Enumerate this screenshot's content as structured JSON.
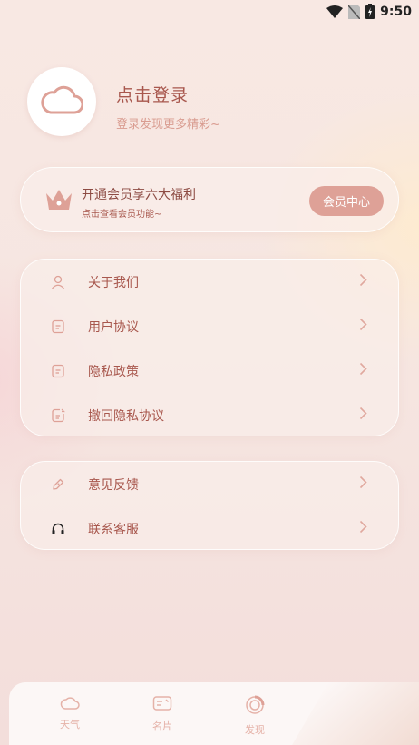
{
  "status_bar": {
    "time": "9:50"
  },
  "profile": {
    "title": "点击登录",
    "subtitle": "登录发现更多精彩~",
    "avatar_icon": "cloud-icon"
  },
  "vip": {
    "title": "开通会员享六大福利",
    "subtitle": "点击查看会员功能~",
    "button_label": "会员中心",
    "icon": "crown-icon"
  },
  "menu_group_1": {
    "items": [
      {
        "label": "关于我们",
        "icon": "person-icon"
      },
      {
        "label": "用户协议",
        "icon": "document-icon"
      },
      {
        "label": "隐私政策",
        "icon": "document-icon"
      },
      {
        "label": "撤回隐私协议",
        "icon": "revoke-document-icon"
      }
    ]
  },
  "menu_group_2": {
    "items": [
      {
        "label": "意见反馈",
        "icon": "edit-icon"
      },
      {
        "label": "联系客服",
        "icon": "headset-icon"
      }
    ]
  },
  "bottom_nav": {
    "items": [
      {
        "label": "天气",
        "icon": "cloud-icon"
      },
      {
        "label": "名片",
        "icon": "card-icon"
      },
      {
        "label": "发现",
        "icon": "discover-icon"
      }
    ]
  },
  "colors": {
    "accent": "#a8574d",
    "button": "#dea197",
    "background": "#f7e7e2"
  }
}
